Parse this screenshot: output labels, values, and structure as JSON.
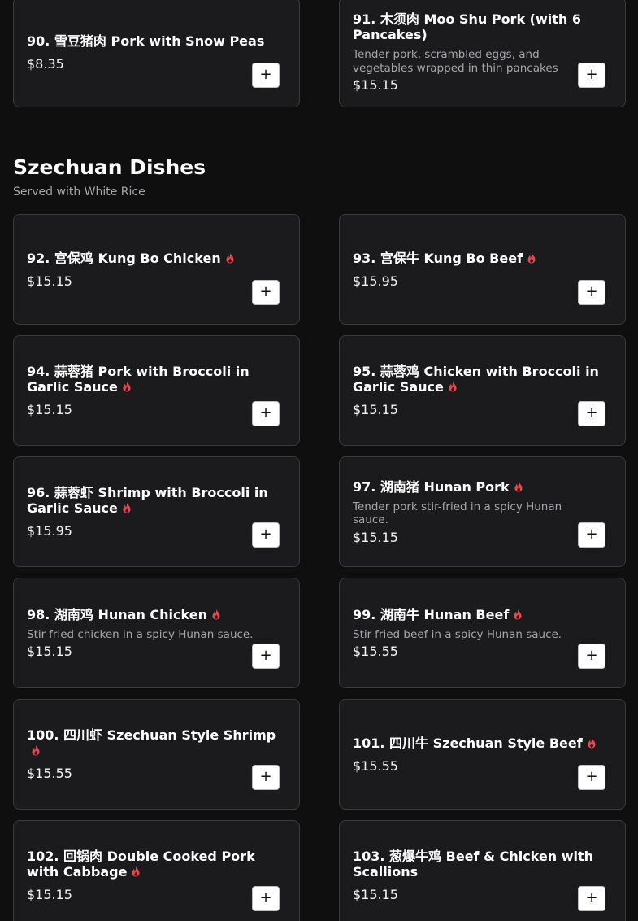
{
  "prev_section": {
    "items": [
      {
        "title": "90. 雪豆猪肉 Pork with Snow Peas",
        "price": "$8.35",
        "description": ""
      },
      {
        "title": "91. 木须肉 Moo Shu Pork (with 6 Pancakes)",
        "price": "$15.15",
        "description": "Tender pork, scrambled eggs, and vegetables wrapped in thin pancakes"
      }
    ]
  },
  "section": {
    "title": "Szechuan Dishes",
    "subtitle": "Served with White Rice",
    "items": [
      {
        "title": "92. 宫保鸡 Kung Bo Chicken",
        "price": "$15.15",
        "description": "",
        "spicy": true
      },
      {
        "title": "93. 宫保牛 Kung Bo Beef",
        "price": "$15.95",
        "description": "",
        "spicy": true
      },
      {
        "title": "94. 蒜蓉猪 Pork with Broccoli in Garlic Sauce",
        "price": "$15.15",
        "description": "",
        "spicy": true
      },
      {
        "title": "95. 蒜蓉鸡 Chicken with Broccoli in Garlic Sauce",
        "price": "$15.15",
        "description": "",
        "spicy": true
      },
      {
        "title": "96. 蒜蓉虾 Shrimp with Broccoli in Garlic Sauce",
        "price": "$15.95",
        "description": "",
        "spicy": true
      },
      {
        "title": "97. 湖南猪 Hunan Pork",
        "price": "$15.15",
        "description": "Tender pork stir-fried in a spicy Hunan sauce.",
        "spicy": true
      },
      {
        "title": "98. 湖南鸡 Hunan Chicken",
        "price": "$15.15",
        "description": "Stir-fried chicken in a spicy Hunan sauce.",
        "spicy": true
      },
      {
        "title": "99. 湖南牛 Hunan Beef",
        "price": "$15.55",
        "description": "Stir-fried beef in a spicy Hunan sauce.",
        "spicy": true
      },
      {
        "title": "100. 四川虾 Szechuan Style Shrimp",
        "price": "$15.55",
        "description": "",
        "spicy": true
      },
      {
        "title": "101. 四川牛 Szechuan Style Beef",
        "price": "$15.55",
        "description": "",
        "spicy": true
      },
      {
        "title": "102. 回锅肉 Double Cooked Pork with Cabbage",
        "price": "$15.15",
        "description": "",
        "spicy": true
      },
      {
        "title": "103. 葱爆牛鸡 Beef & Chicken with Scallions",
        "price": "$15.15",
        "description": "",
        "spicy": false
      }
    ]
  },
  "ui": {
    "add_label": "+",
    "spicy_icon": "flame-icon",
    "spicy_color": "#e5484d",
    "accent": "#ffffff"
  }
}
